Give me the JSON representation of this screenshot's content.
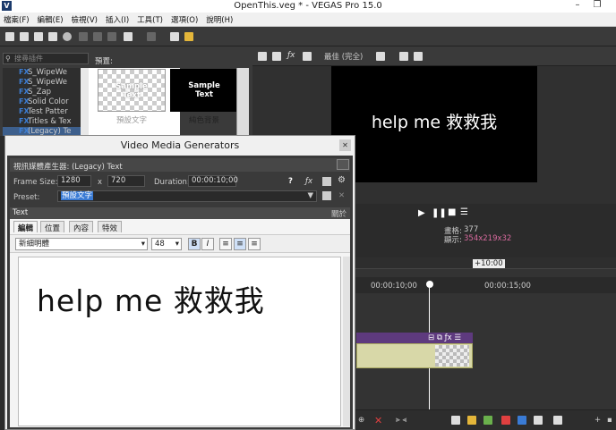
{
  "app": {
    "title": "OpenThis.veg * - VEGAS Pro 15.0",
    "logo": "V"
  },
  "window_controls": [
    "minimize-icon",
    "restore-icon"
  ],
  "menu": [
    "檔案(F)",
    "編輯(E)",
    "檢視(V)",
    "插入(I)",
    "工具(T)",
    "選項(O)",
    "說明(H)"
  ],
  "generators": {
    "search_placeholder": "搜尋插件",
    "items": [
      {
        "badge": "FX",
        "label": "S_WipeWe"
      },
      {
        "badge": "FX",
        "label": "S_WipeWe"
      },
      {
        "badge": "FX",
        "label": "S_Zap"
      },
      {
        "badge": "FX",
        "label": "Solid Color"
      },
      {
        "badge": "FX",
        "label": "Test Patter"
      },
      {
        "badge": "FX",
        "label": "Titles & Tex"
      },
      {
        "badge": "FX",
        "label": "(Legacy) Te"
      }
    ],
    "preview_label": "預置:",
    "thumbs": [
      {
        "text": "Sample\nText",
        "caption": "預設文字"
      },
      {
        "text": "Sample\nText",
        "caption": "純色背景"
      }
    ]
  },
  "preview": {
    "video_text": "help me 救救我",
    "toolbar_label": "最佳 (完全)"
  },
  "transport": {
    "frame_label": "畫格:",
    "frame_value": "377",
    "display_label": "顯示:",
    "display_value": "354x219x32"
  },
  "timeline": {
    "marker": "+10:00",
    "times": [
      "00:00:10;00",
      "00:00:15;00"
    ]
  },
  "dialog": {
    "title": "Video Media Generators",
    "generator_label": "視訊媒體產生器: (Legacy) Text",
    "frame_size_label": "Frame Size:",
    "width": "1280",
    "x": "x",
    "height": "720",
    "duration_label": "Duration:",
    "duration": "00:00:10;00",
    "preset_label": "Preset:",
    "preset_value": "預設文字",
    "text_header": "Text",
    "text_header_right": "關於",
    "tabs": [
      "編輯",
      "位置",
      "內容",
      "特效"
    ],
    "font": "新細明體",
    "size": "48",
    "bold": "B",
    "italic": "I",
    "content": "help me 救救我"
  }
}
